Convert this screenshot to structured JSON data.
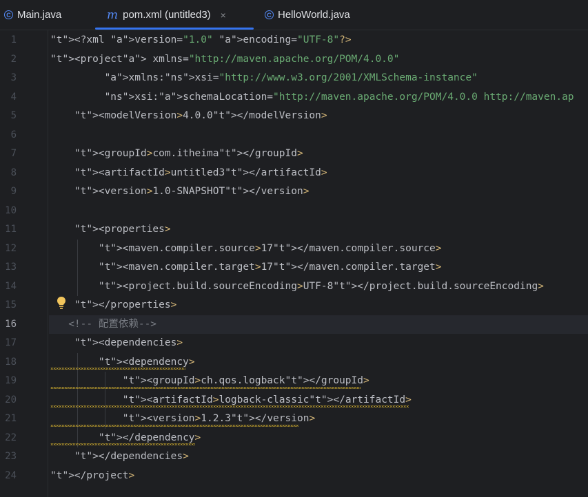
{
  "tabs": [
    {
      "label": "Main.java",
      "icon": "java-class-icon",
      "active": false
    },
    {
      "label": "pom.xml (untitled3)",
      "icon": "maven-icon",
      "active": true
    },
    {
      "label": "HelloWorld.java",
      "icon": "java-class-icon",
      "active": false
    }
  ],
  "tab_close_glyph": "×",
  "colors": {
    "accent": "#3574f0",
    "tag": "#d5b778",
    "string": "#6aab73",
    "namespace": "#c77dbb",
    "comment": "#7a7e85"
  },
  "editor": {
    "current_line": 16,
    "line_numbers": [
      "1",
      "2",
      "3",
      "4",
      "5",
      "6",
      "7",
      "8",
      "9",
      "10",
      "11",
      "12",
      "13",
      "14",
      "15",
      "16",
      "17",
      "18",
      "19",
      "20",
      "21",
      "22",
      "23",
      "24"
    ],
    "lines": [
      {
        "n": 1,
        "text": "<?xml version=\"1.0\" encoding=\"UTF-8\"?>"
      },
      {
        "n": 2,
        "text": "<project xmlns=\"http://maven.apache.org/POM/4.0.0\""
      },
      {
        "n": 3,
        "text": "         xmlns:xsi=\"http://www.w3.org/2001/XMLSchema-instance\""
      },
      {
        "n": 4,
        "text": "         xsi:schemaLocation=\"http://maven.apache.org/POM/4.0.0 http://maven.ap"
      },
      {
        "n": 5,
        "text": "    <modelVersion>4.0.0</modelVersion>"
      },
      {
        "n": 6,
        "text": ""
      },
      {
        "n": 7,
        "text": "    <groupId>com.itheima</groupId>"
      },
      {
        "n": 8,
        "text": "    <artifactId>untitled3</artifactId>"
      },
      {
        "n": 9,
        "text": "    <version>1.0-SNAPSHOT</version>"
      },
      {
        "n": 10,
        "text": ""
      },
      {
        "n": 11,
        "text": "    <properties>"
      },
      {
        "n": 12,
        "text": "        <maven.compiler.source>17</maven.compiler.source>"
      },
      {
        "n": 13,
        "text": "        <maven.compiler.target>17</maven.compiler.target>"
      },
      {
        "n": 14,
        "text": "        <project.build.sourceEncoding>UTF-8</project.build.sourceEncoding>"
      },
      {
        "n": 15,
        "text": "    </properties>"
      },
      {
        "n": 16,
        "text": "   <!-- 配置依赖-->"
      },
      {
        "n": 17,
        "text": "    <dependencies>"
      },
      {
        "n": 18,
        "text": "        <dependency>"
      },
      {
        "n": 19,
        "text": "            <groupId>ch.qos.logback</groupId>"
      },
      {
        "n": 20,
        "text": "            <artifactId>logback-classic</artifactId>"
      },
      {
        "n": 21,
        "text": "            <version>1.2.3</version>"
      },
      {
        "n": 22,
        "text": "        </dependency>"
      },
      {
        "n": 23,
        "text": "    </dependencies>"
      },
      {
        "n": 24,
        "text": "</project>"
      }
    ]
  }
}
